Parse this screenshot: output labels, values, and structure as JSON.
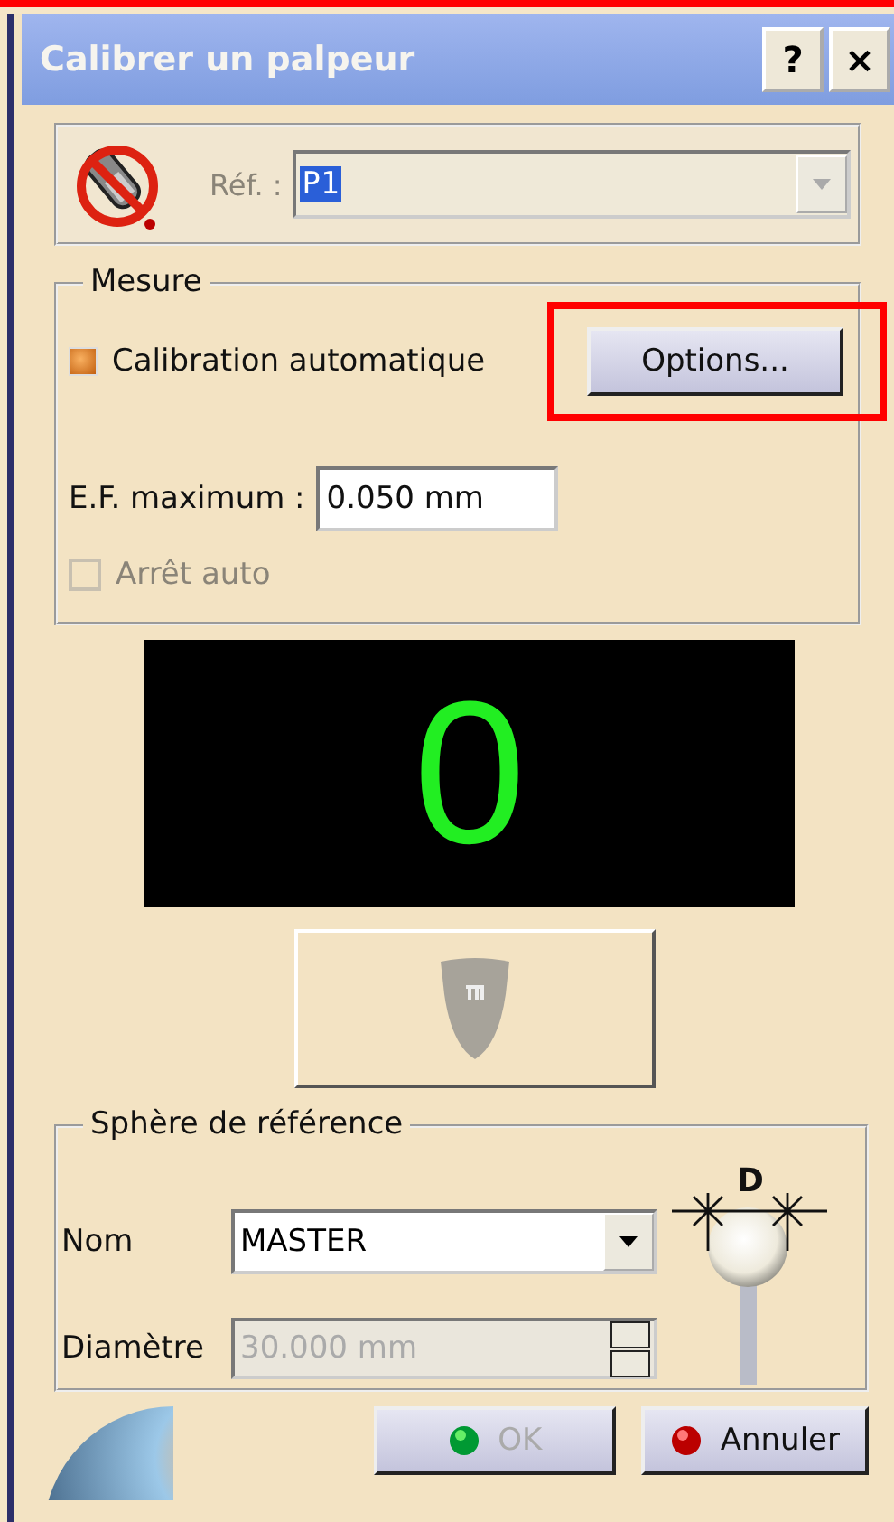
{
  "window": {
    "title": "Calibrer un palpeur",
    "help_button": "?",
    "close_button": "×"
  },
  "probe": {
    "label": "Réf. :",
    "value": "P1",
    "disabled": true
  },
  "measure": {
    "legend": "Mesure",
    "auto_calibration": {
      "label": "Calibration automatique",
      "checked": true
    },
    "options_button": {
      "label": "Options...",
      "highlighted": true
    },
    "max_error": {
      "label": "E.F. maximum :",
      "value": "0.050 mm"
    },
    "auto_stop": {
      "label": "Arrêt auto",
      "checked": false,
      "disabled": true
    }
  },
  "counter": "0",
  "capture_button": {
    "disabled": true
  },
  "sphere": {
    "legend": "Sphère de référence",
    "name": {
      "label": "Nom",
      "value": "MASTER"
    },
    "diameter": {
      "label": "Diamètre",
      "value": "30.000 mm",
      "disabled": true
    },
    "diagram_label": "D"
  },
  "buttons": [
    {
      "label": "OK",
      "kind": "ok",
      "disabled": true
    },
    {
      "label": "Annuler",
      "kind": "cancel",
      "disabled": false
    }
  ]
}
